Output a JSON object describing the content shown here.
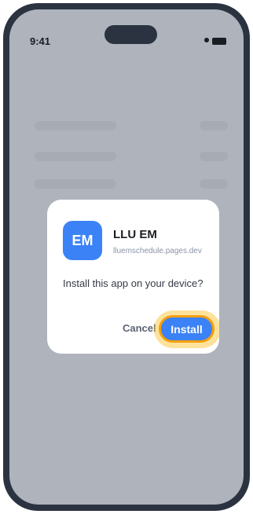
{
  "status_bar": {
    "time": "9:41"
  },
  "dialog": {
    "app_icon_text": "EM",
    "app_name": "LLU EM",
    "app_domain": "lluemschedule.pages.dev",
    "prompt": "Install this app on your device?",
    "cancel_label": "Cancel",
    "install_label": "Install"
  },
  "colors": {
    "accent": "#3b82f6",
    "highlight": "#f59e0b",
    "phone_frame": "#2b3340",
    "screen_dim": "#aeb3bc"
  }
}
